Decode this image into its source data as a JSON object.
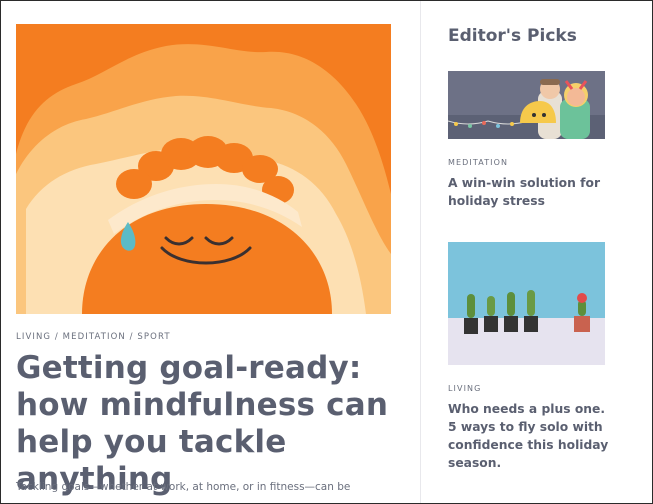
{
  "article": {
    "tags": "LIVING / MEDITATION / SPORT",
    "headline": "Getting goal-ready: how mindfulness can help you tackle anything",
    "excerpt": "Tackling goals—whether at work, at home, or in fitness—can be"
  },
  "sidebar": {
    "title": "Editor's Picks",
    "picks": [
      {
        "category": "MEDITATION",
        "title": "A win-win solution for holiday stress"
      },
      {
        "category": "LIVING",
        "title": "Who needs a plus one. 5 ways to fly solo with confidence this holiday season."
      }
    ]
  },
  "colors": {
    "accent_orange": "#f47d20",
    "text": "#5a5f70",
    "sky_blue": "#7cc3dc"
  }
}
